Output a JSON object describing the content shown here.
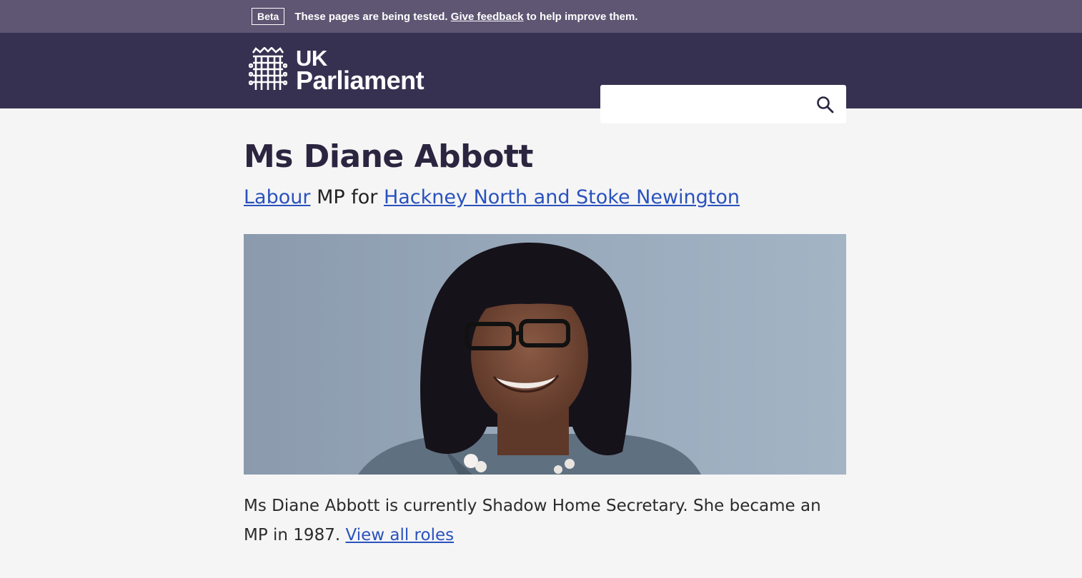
{
  "beta_banner": {
    "tag": "Beta",
    "text_before": "These pages are being tested.",
    "link": "Give feedback",
    "text_after": "to help improve them."
  },
  "header": {
    "logo_line1": "UK",
    "logo_line2": "Parliament",
    "search_placeholder": "",
    "search_icon": "search-icon"
  },
  "member": {
    "name": "Ms Diane Abbott",
    "party": "Labour",
    "mp_for": "MP for",
    "constituency": "Hackney North and Stoke Newington",
    "bio_text": "Ms Diane Abbott is currently Shadow Home Secretary. She became an MP in 1987.",
    "roles_link": "View all roles"
  },
  "colors": {
    "banner": "#5e5673",
    "header": "#373151",
    "link": "#2a52be",
    "heading": "#2b2540"
  }
}
